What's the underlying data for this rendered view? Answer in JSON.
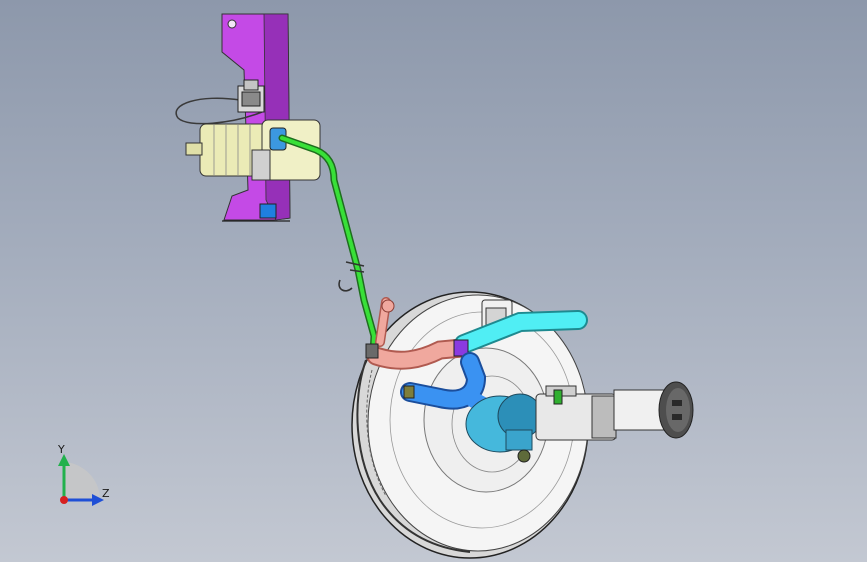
{
  "viewport": {
    "background_top": "#8d98ab",
    "background_bottom": "#c3c8d2"
  },
  "triad": {
    "y_label": "Y",
    "z_label": "Z",
    "y_color": "#22b14c",
    "z_color": "#1f4fd6",
    "x_color": "#d62020"
  },
  "parts": {
    "bracket_color": "#c040e0",
    "motor_color": "#e8e8b0",
    "green_pipe_color": "#2ecc2e",
    "pink_hose_color": "#e89a90",
    "cyan_hose_color": "#3fe0e8",
    "blue_hose_color": "#2f8cf0",
    "booster_color": "#f2f2f2",
    "valve_color": "#40b4d8",
    "cap_color": "#555555"
  }
}
